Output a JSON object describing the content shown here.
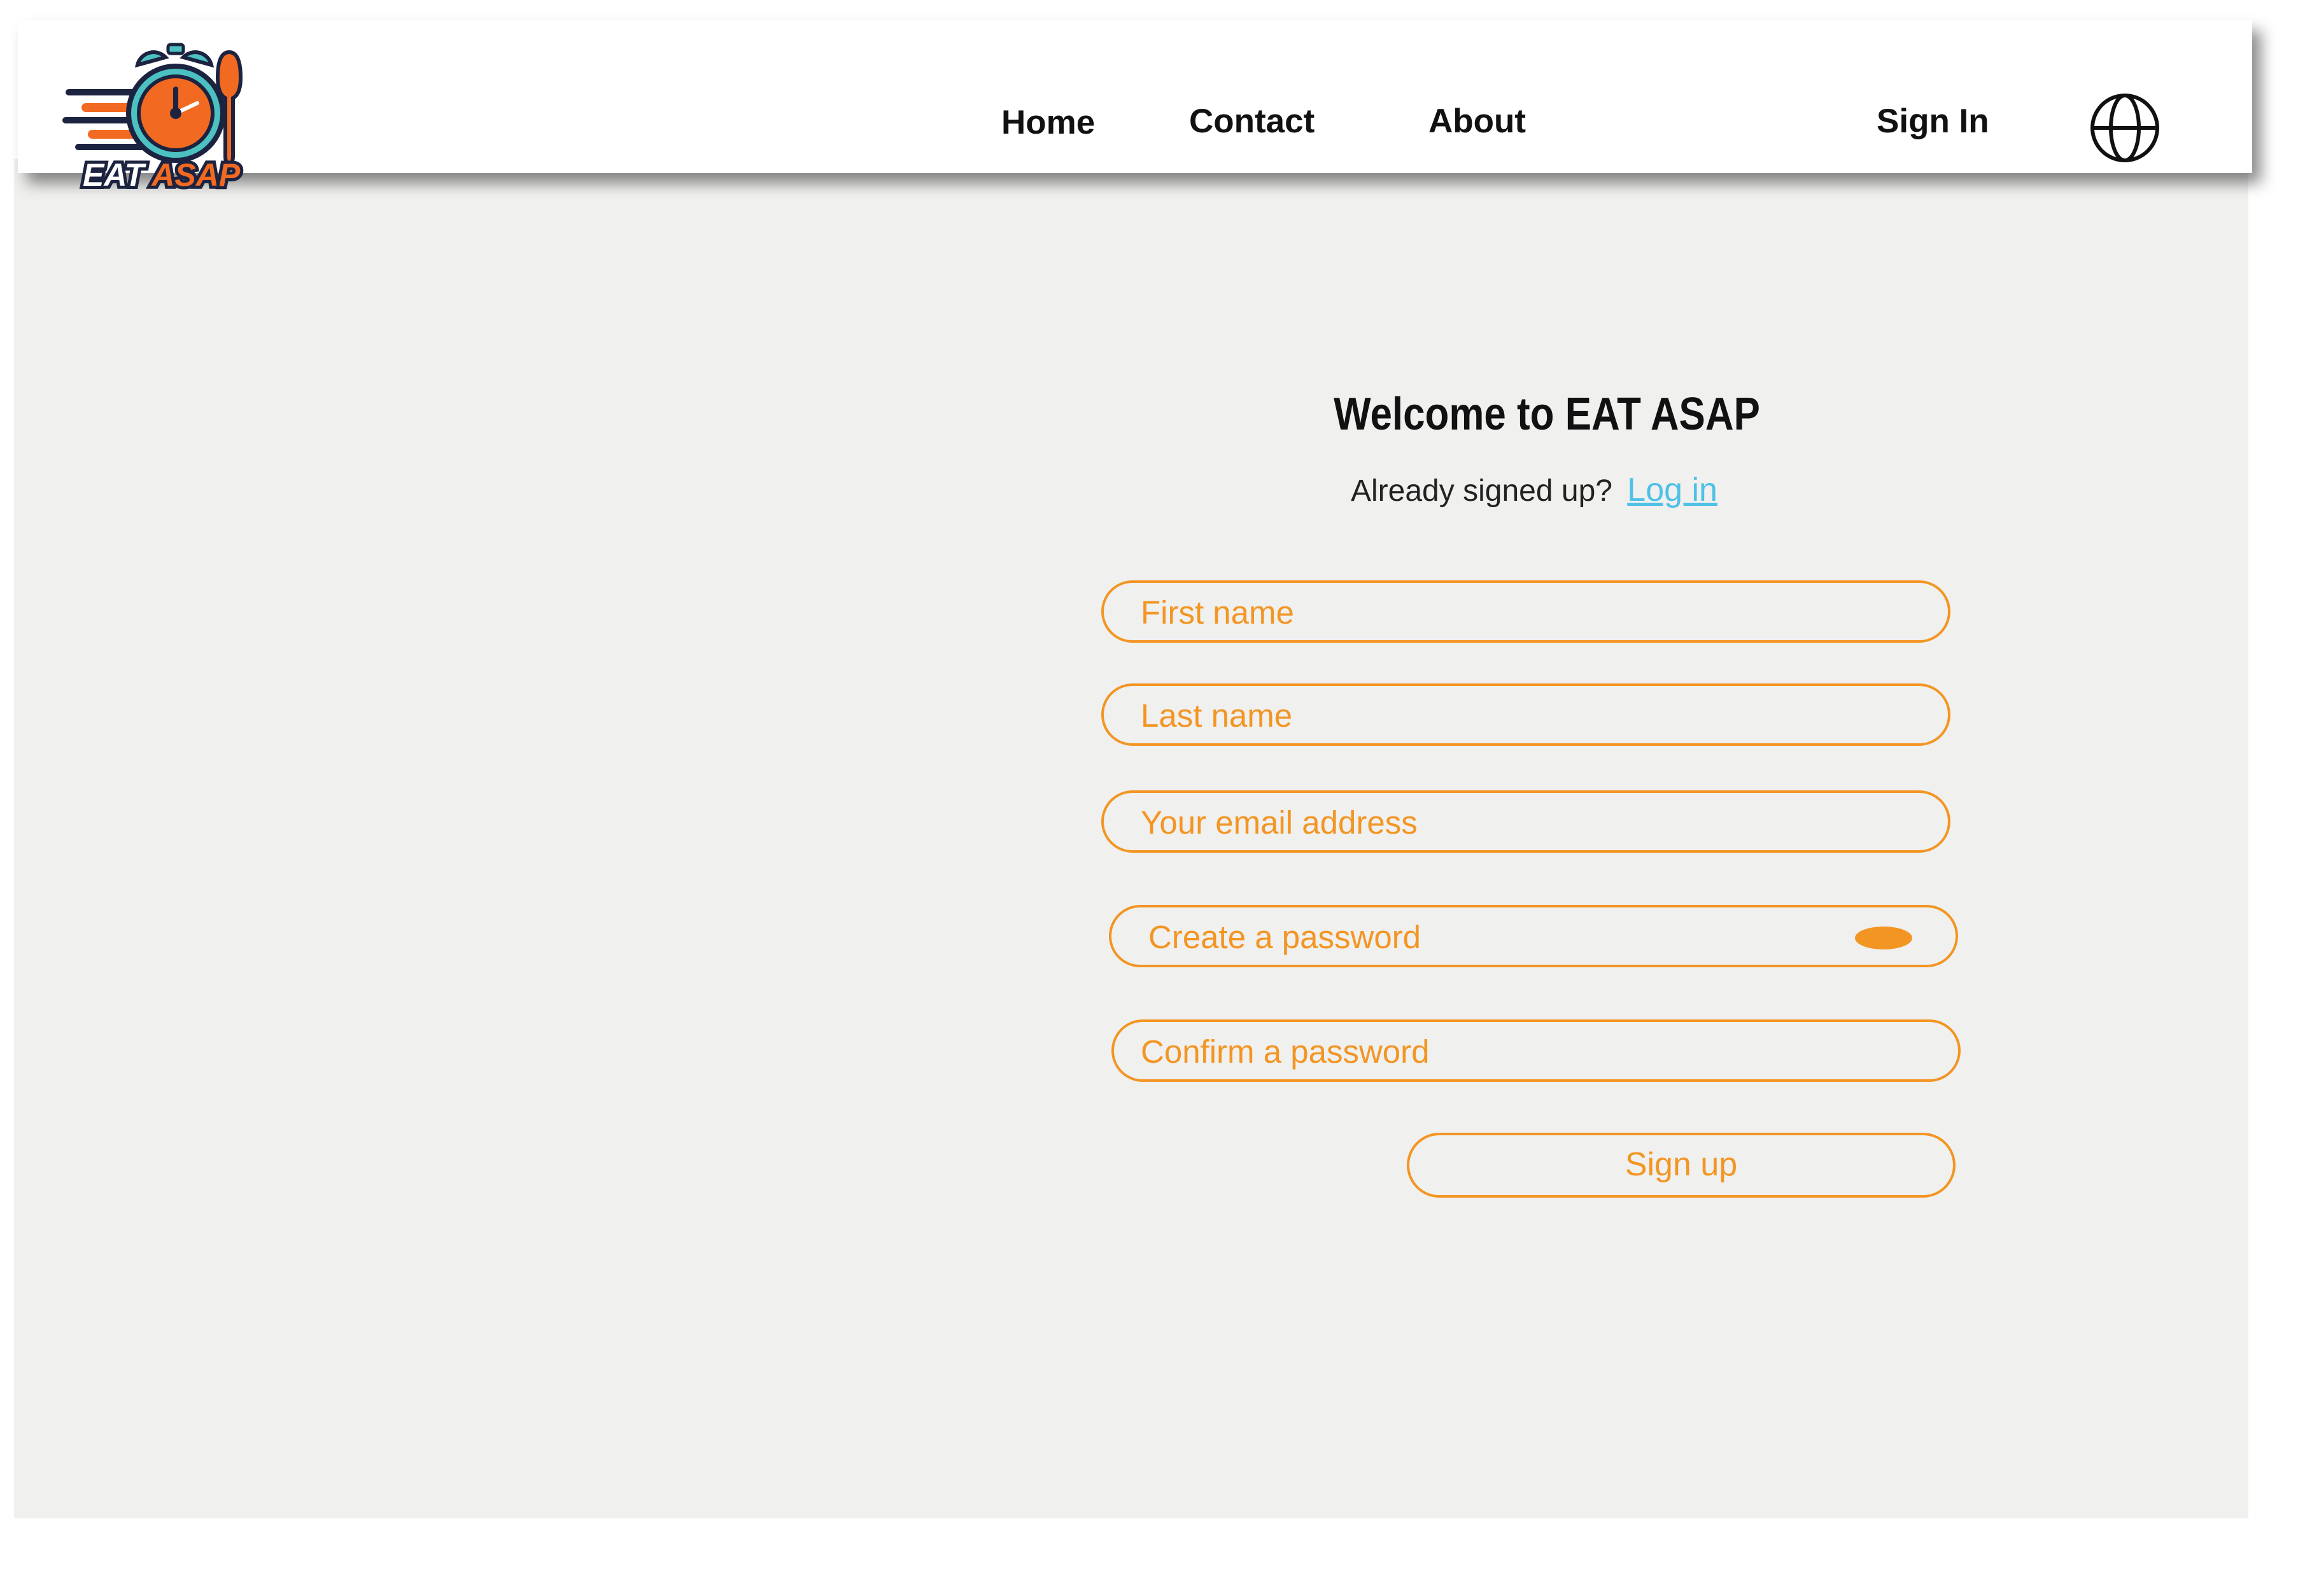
{
  "brand": {
    "name": "EAT ASAP",
    "colors": {
      "accent": "#f39523",
      "logo_orange": "#f26a21",
      "logo_teal": "#4cc1c1",
      "logo_navy": "#1c2340",
      "link": "#4fc0e8",
      "background": "#f0f0ee"
    }
  },
  "nav": {
    "links": [
      {
        "label": "Home"
      },
      {
        "label": "Contact"
      },
      {
        "label": "About"
      }
    ],
    "sign_in": "Sign In",
    "language_icon": "globe-icon"
  },
  "signup": {
    "title": "Welcome to EAT ASAP",
    "already_text": "Already signed up?",
    "login_label": "Log in",
    "fields": {
      "first_name": "First name",
      "last_name": "Last name",
      "email": "Your email address",
      "password": "Create a password",
      "confirm_password": "Confirm a password"
    },
    "password_toggle_icon": "eye-toggle-icon",
    "submit_label": "Sign up"
  }
}
